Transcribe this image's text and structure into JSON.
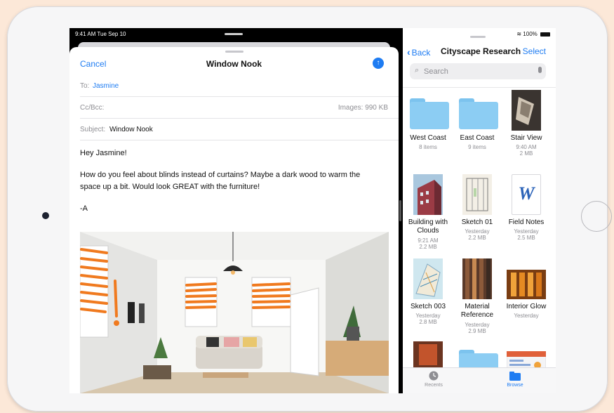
{
  "mail": {
    "status_time": "9:41 AM  Tue Sep 10",
    "cancel_label": "Cancel",
    "title": "Window Nook",
    "to_label": "To:",
    "to_value": "Jasmine",
    "ccbcc_label": "Cc/Bcc:",
    "images_label": "Images:",
    "images_value": "990 KB",
    "subject_label": "Subject:",
    "subject_value": "Window Nook",
    "greeting": "Hey Jasmine!",
    "body": "How do you feel about blinds instead of curtains? Maybe a dark wood to warm the space up a bit. Would look GREAT with the furniture!",
    "signoff": "-A"
  },
  "files": {
    "battery": "100%",
    "back_label": "Back",
    "title": "Cityscape Research",
    "select_label": "Select",
    "search_placeholder": "Search",
    "items": [
      {
        "name": "West Coast",
        "meta": [
          "8 items"
        ],
        "kind": "folder"
      },
      {
        "name": "East Coast",
        "meta": [
          "9 items"
        ],
        "kind": "folder"
      },
      {
        "name": "Stair View",
        "meta": [
          "9:40 AM",
          "2 MB"
        ],
        "kind": "photo-stair"
      },
      {
        "name": "Building with Clouds",
        "meta": [
          "9:21 AM",
          "2.2 MB"
        ],
        "kind": "photo-building"
      },
      {
        "name": "Sketch 01",
        "meta": [
          "Yesterday",
          "2.2 MB"
        ],
        "kind": "sketch-01"
      },
      {
        "name": "Field Notes",
        "meta": [
          "Yesterday",
          "2.5 MB"
        ],
        "kind": "word-doc"
      },
      {
        "name": "Sketch 003",
        "meta": [
          "Yesterday",
          "2.8 MB"
        ],
        "kind": "sketch-003"
      },
      {
        "name": "Material Reference",
        "meta": [
          "Yesterday",
          "2.9 MB"
        ],
        "kind": "photo-material"
      },
      {
        "name": "Interior Glow",
        "meta": [
          "Yesterday"
        ],
        "kind": "photo-interior"
      }
    ],
    "word_glyph": "W",
    "tabs": [
      {
        "label": "Recents",
        "active": false
      },
      {
        "label": "Browse",
        "active": true
      }
    ]
  },
  "colors": {
    "accent": "#1e7cf2",
    "folder": "#8ccdf3",
    "annotation": "#f07a1f"
  }
}
